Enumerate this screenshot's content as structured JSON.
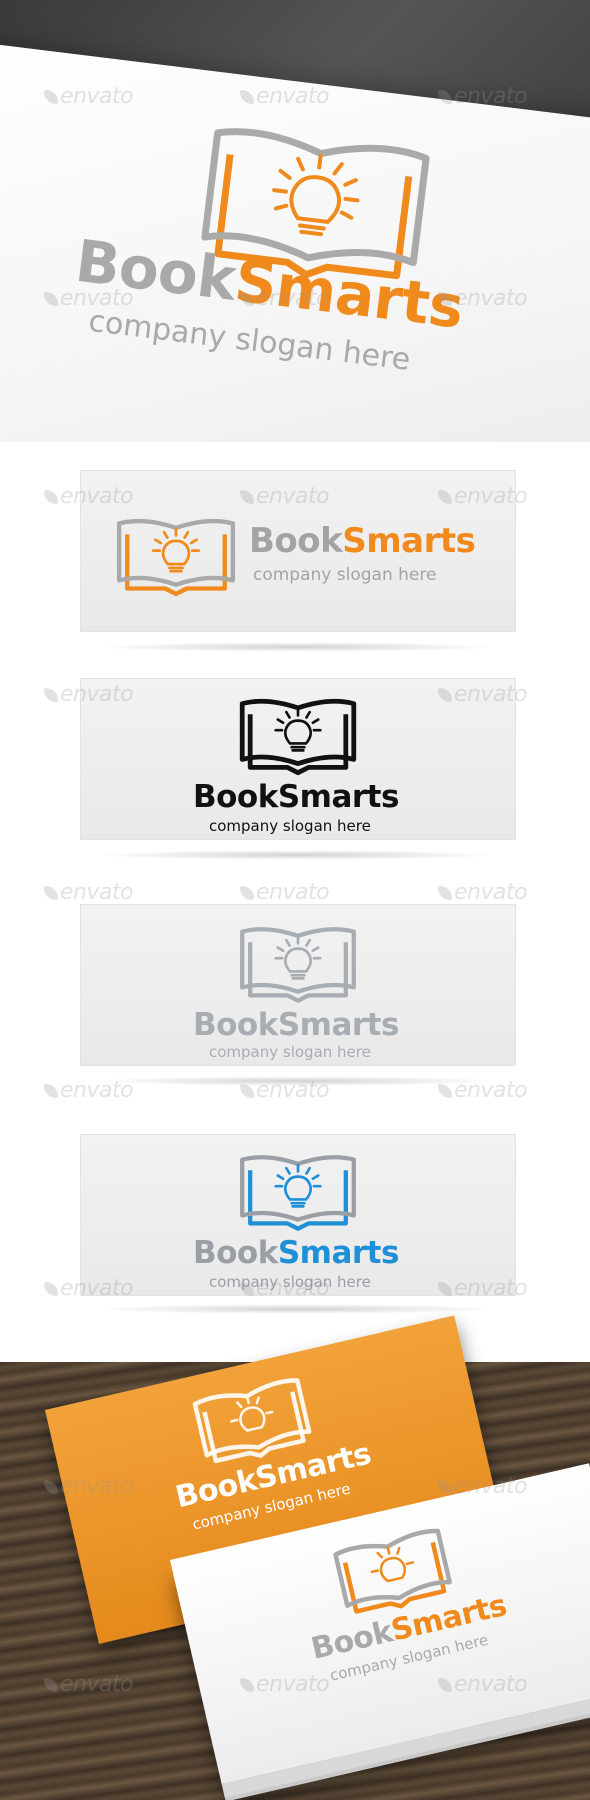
{
  "brand": {
    "word1": "Book",
    "word2": "Smarts",
    "slogan": "company slogan here"
  },
  "watermark": {
    "text": "envato"
  },
  "variants": [
    {
      "name": "color-horizontal",
      "book_color": "#f08a1c",
      "bulb_color": "#f08a1c",
      "word1_color": "#9b9b9b",
      "word2_color": "#f08a1c",
      "slogan_color": "#9b9b9b"
    },
    {
      "name": "black",
      "book_color": "#111111",
      "bulb_color": "#111111",
      "word1_color": "#111111",
      "word2_color": "#111111",
      "slogan_color": "#111111"
    },
    {
      "name": "gray",
      "book_color": "#a7adb3",
      "bulb_color": "#a7adb3",
      "word1_color": "#a7adb3",
      "word2_color": "#a7adb3",
      "slogan_color": "#a7adb3"
    },
    {
      "name": "blue",
      "book_color": "#1f8fd6",
      "bulb_color": "#1f8fd6",
      "word1_color": "#9a9fa5",
      "word2_color": "#1f8fd6",
      "slogan_color": "#9a9fa5"
    }
  ],
  "colors": {
    "orange": "#f08a1c",
    "gray": "#9b9b9b",
    "blue": "#1f8fd6"
  }
}
